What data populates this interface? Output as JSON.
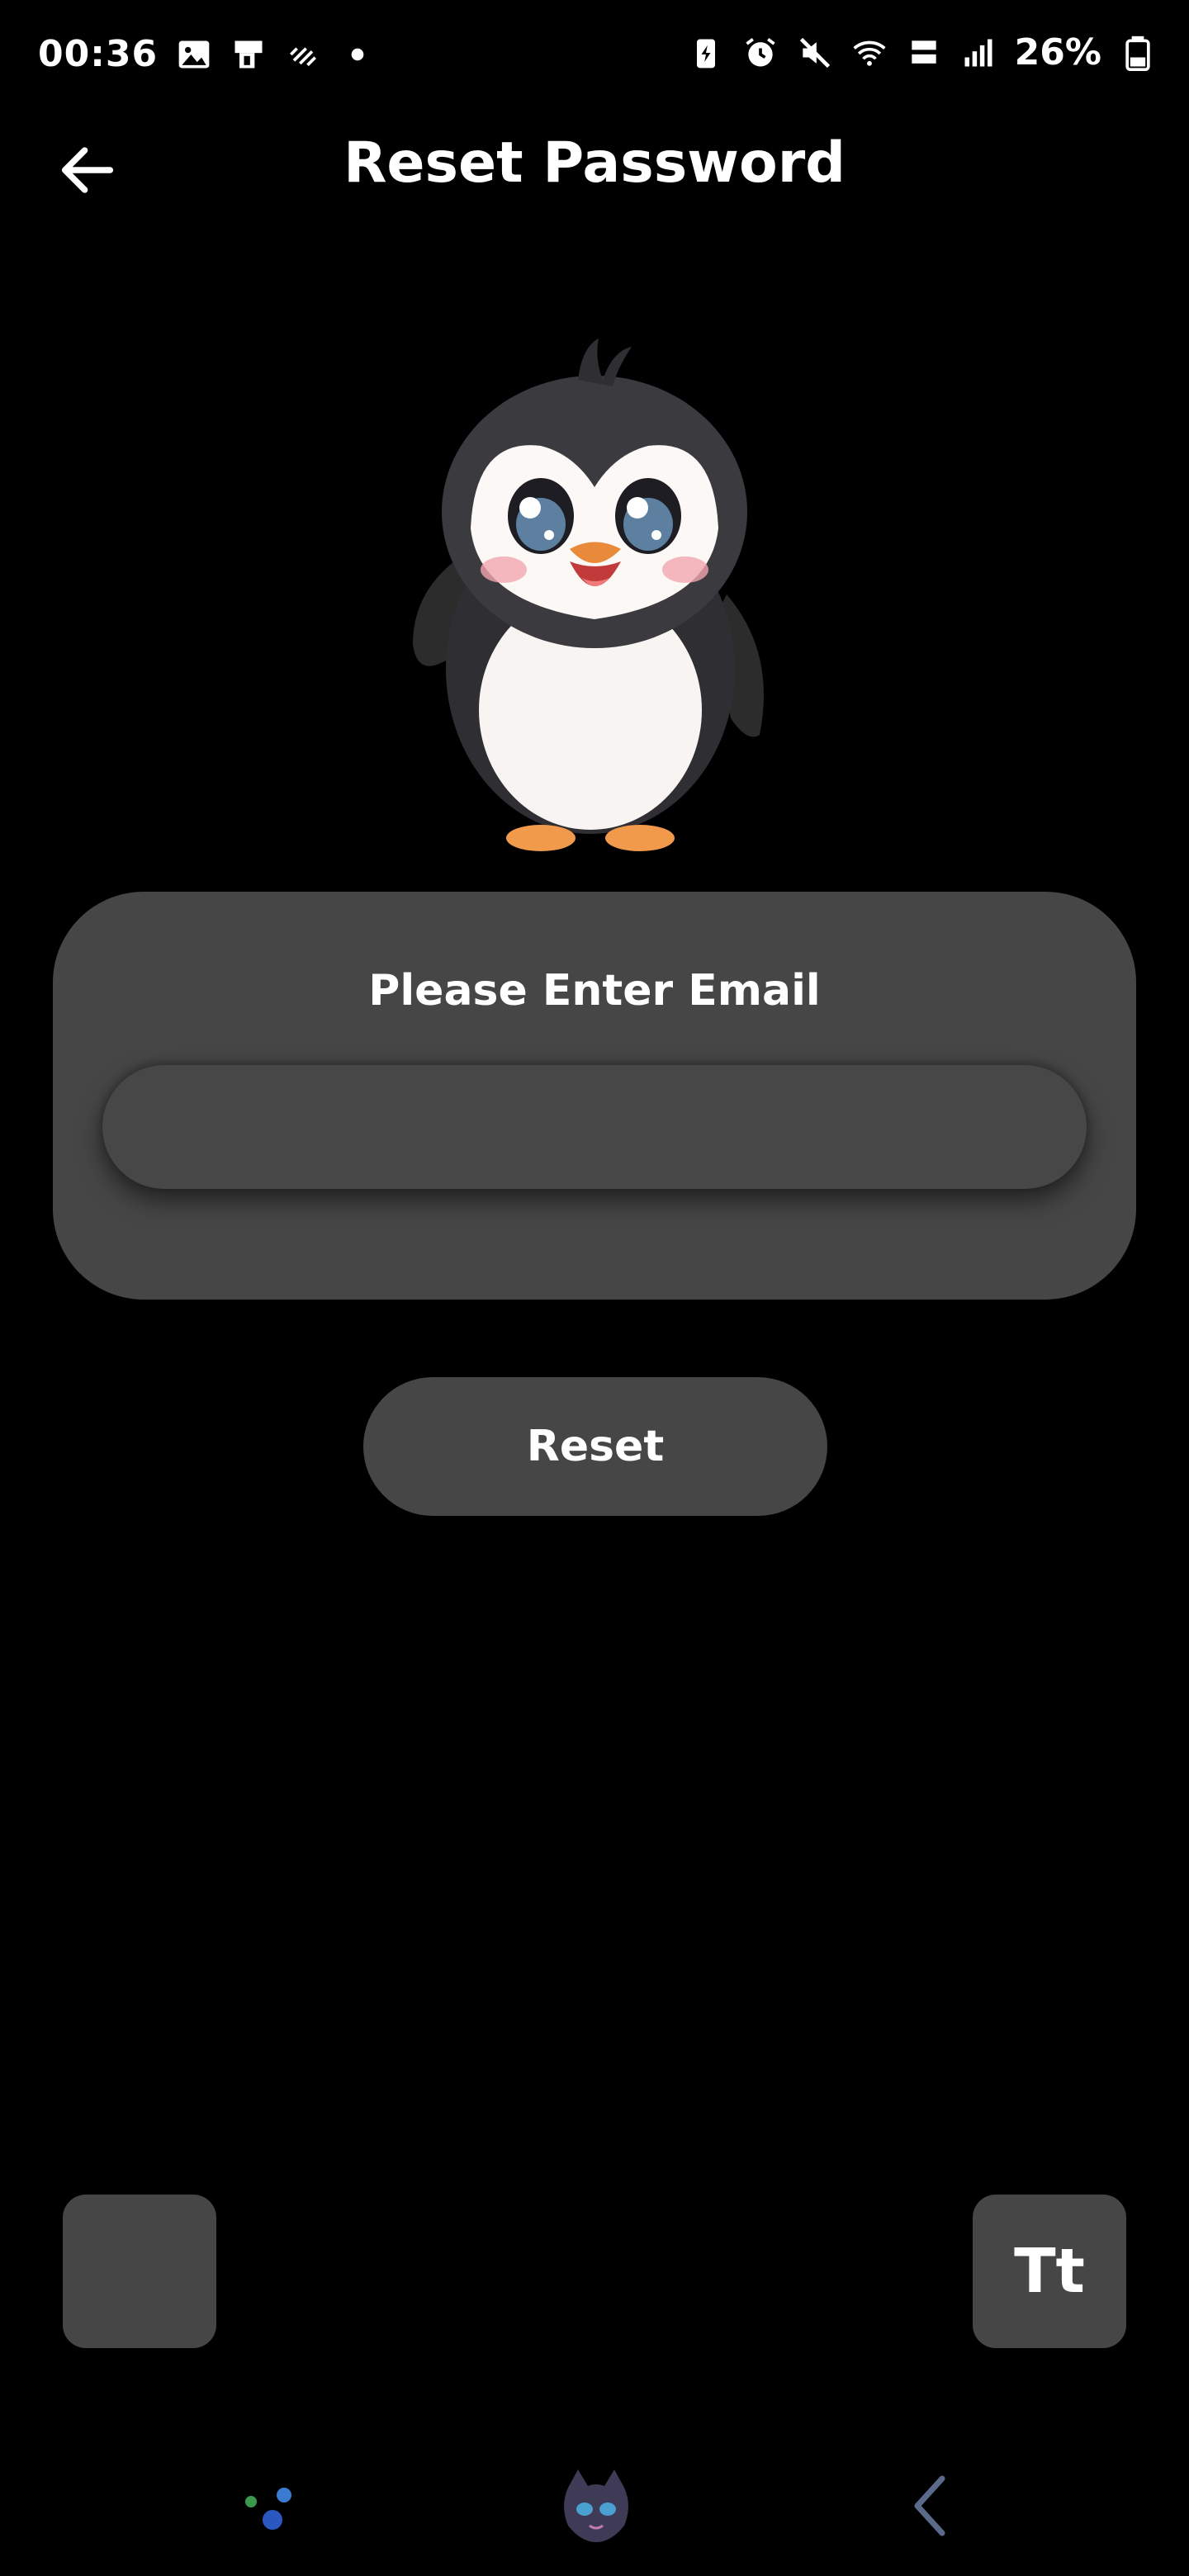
{
  "status_bar": {
    "time": "00:36",
    "battery_percent": "26%"
  },
  "header": {
    "title": "Reset Password"
  },
  "form": {
    "label": "Please Enter Email",
    "email_value": "",
    "email_placeholder": ""
  },
  "actions": {
    "reset_label": "Reset",
    "font_size_label": "Tt"
  },
  "theme": {
    "background": "#000000",
    "surface": "#464646",
    "text": "#ffffff"
  },
  "icons": {
    "back": "arrow-left-icon",
    "mascot": "penguin-mascot",
    "dark_mode": "moon-icon",
    "nav": [
      "sparkle-orbs-icon",
      "cat-avatar-icon",
      "back-arrow-icon"
    ]
  }
}
